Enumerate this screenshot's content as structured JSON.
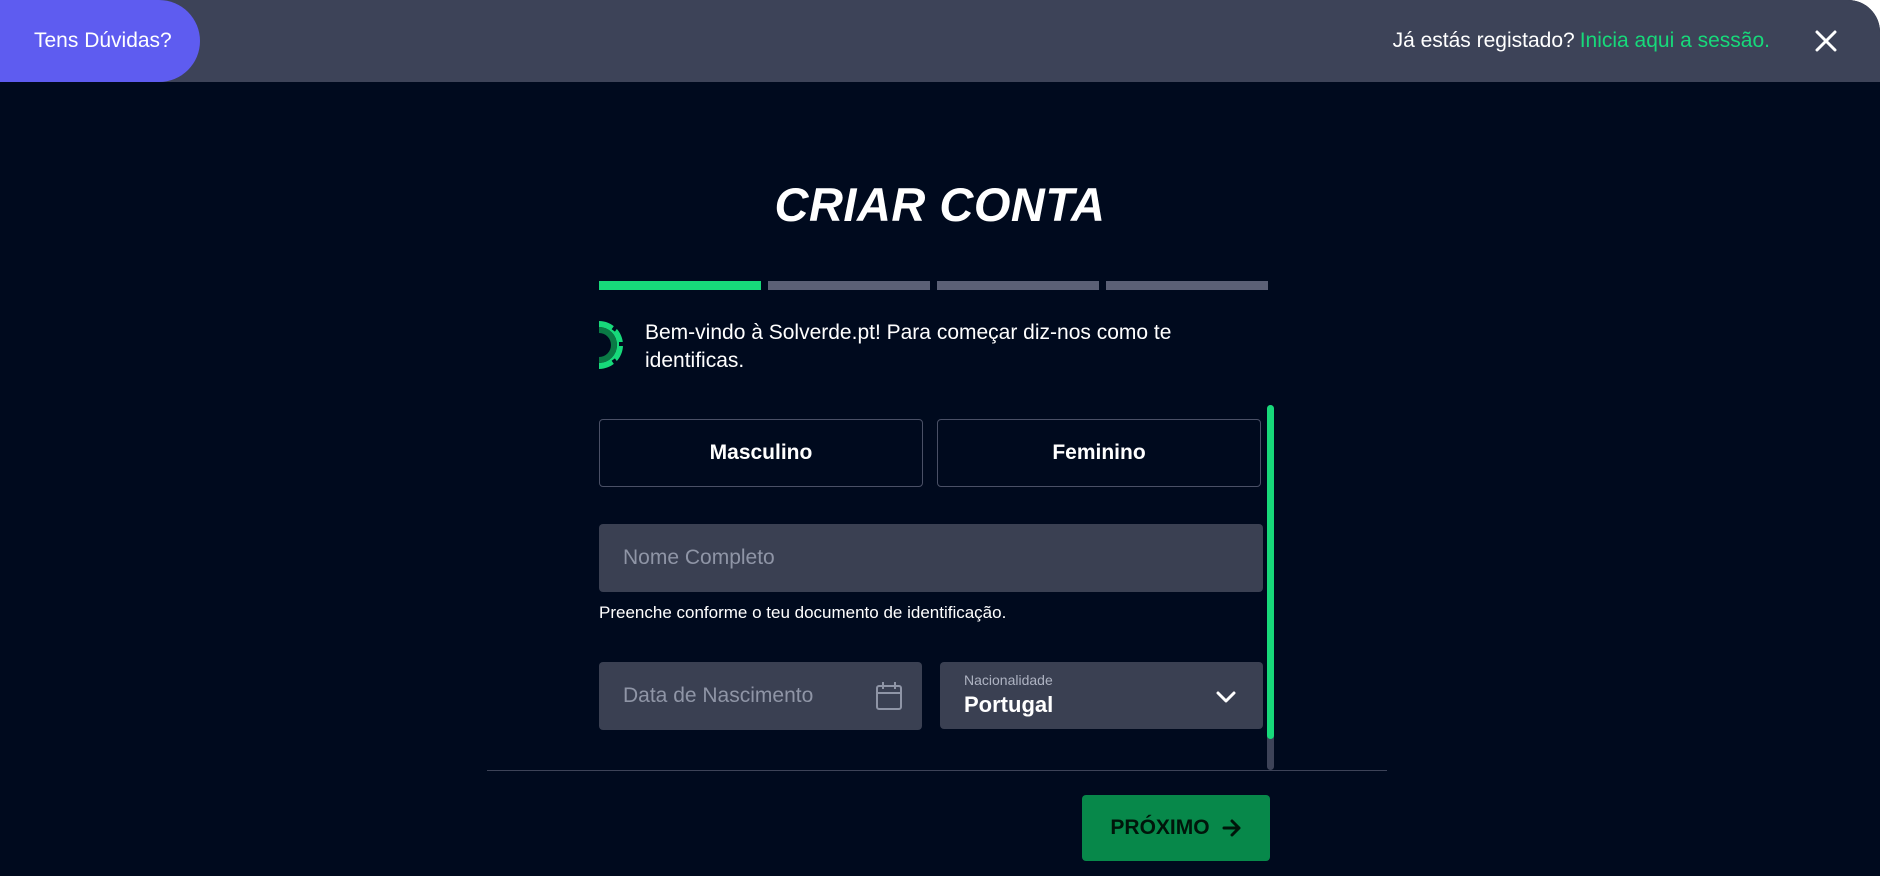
{
  "topbar": {
    "help_label": "Tens Dúvidas?",
    "login_prompt": "Já estás registado?",
    "login_link": "Inicia aqui a sessão."
  },
  "page": {
    "title": "CRIAR CONTA",
    "intro": "Bem-vindo à Solverde.pt! Para começar diz-nos como te identificas."
  },
  "steps": {
    "total": 4,
    "current": 1
  },
  "form": {
    "gender_options": [
      "Masculino",
      "Feminino"
    ],
    "full_name": {
      "placeholder": "Nome Completo",
      "value": "",
      "helper": "Preenche conforme o teu documento de identificação."
    },
    "birth_date": {
      "placeholder": "Data de Nascimento",
      "value": ""
    },
    "nationality": {
      "label": "Nacionalidade",
      "value": "Portugal"
    }
  },
  "actions": {
    "next_label": "PRÓXIMO"
  },
  "colors": {
    "accent": "#17d97a",
    "help_button": "#5e5cf0",
    "topbar": "#3d4358",
    "background": "#000a1e",
    "next_button": "#07884a"
  },
  "icons": [
    "close-icon",
    "chip-icon",
    "calendar-icon",
    "chevron-down-icon",
    "arrow-right-icon"
  ]
}
